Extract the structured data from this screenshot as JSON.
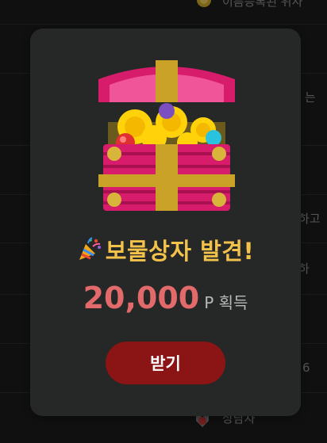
{
  "background": {
    "items": [
      {
        "text": "이름등록된 위사"
      },
      {
        "text": "는"
      },
      {
        "text": "하고"
      },
      {
        "text": "하"
      },
      {
        "text": "6"
      },
      {
        "text": "상담자"
      }
    ]
  },
  "modal": {
    "title": "보물상자 발견!",
    "amount": "20,000",
    "unit": "P 획득",
    "receive_button": "받기",
    "icons": {
      "title": "party-popper-icon",
      "chest": "treasure-chest-icon"
    },
    "colors": {
      "title": "#f2c24a",
      "amount": "#e36a6a",
      "button": "#8b1414",
      "card": "#262727"
    }
  }
}
